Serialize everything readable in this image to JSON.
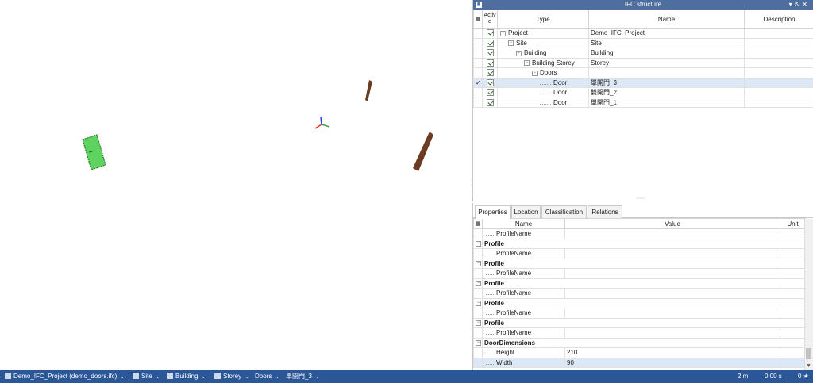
{
  "ifc_structure": {
    "title": "IFC structure",
    "title_icons": [
      "pin-icon",
      "float-icon",
      "close-icon"
    ],
    "columns": {
      "active": "Active",
      "type": "Type",
      "name": "Name",
      "description": "Description"
    },
    "rows": [
      {
        "type": "Project",
        "name": "Demo_IFC_Project",
        "description": "",
        "active": true,
        "selected": false
      },
      {
        "type": "Site",
        "name": "Site",
        "description": "",
        "active": true,
        "selected": false
      },
      {
        "type": "Building",
        "name": "Building",
        "description": "",
        "active": true,
        "selected": false
      },
      {
        "type": "Building Storey",
        "name": "Storey",
        "description": "",
        "active": true,
        "selected": false
      },
      {
        "type": "Doors",
        "name": "",
        "description": "",
        "active": true,
        "selected": false
      },
      {
        "type": "Door",
        "name": "單開門_3",
        "description": "",
        "active": true,
        "selected": true
      },
      {
        "type": "Door",
        "name": "雙開門_2",
        "description": "",
        "active": true,
        "selected": false
      },
      {
        "type": "Door",
        "name": "單開門_1",
        "description": "",
        "active": true,
        "selected": false
      }
    ]
  },
  "properties_panel": {
    "tabs": [
      "Properties",
      "Location",
      "Classification",
      "Relations"
    ],
    "active_tab": "Properties",
    "columns": {
      "name": "Name",
      "value": "Value",
      "unit": "Unit"
    },
    "rows": [
      {
        "kind": "prop",
        "name": "ProfileName",
        "value": "",
        "unit": ""
      },
      {
        "kind": "group",
        "name": "Profile"
      },
      {
        "kind": "prop",
        "name": "ProfileName",
        "value": "",
        "unit": ""
      },
      {
        "kind": "group",
        "name": "Profile"
      },
      {
        "kind": "prop",
        "name": "ProfileName",
        "value": "",
        "unit": ""
      },
      {
        "kind": "group",
        "name": "Profile"
      },
      {
        "kind": "prop",
        "name": "ProfileName",
        "value": "",
        "unit": ""
      },
      {
        "kind": "group",
        "name": "Profile"
      },
      {
        "kind": "prop",
        "name": "ProfileName",
        "value": "",
        "unit": ""
      },
      {
        "kind": "group",
        "name": "Profile"
      },
      {
        "kind": "prop",
        "name": "ProfileName",
        "value": "",
        "unit": ""
      },
      {
        "kind": "group",
        "name": "DoorDimensions"
      },
      {
        "kind": "prop",
        "name": "Height",
        "value": "210",
        "unit": ""
      },
      {
        "kind": "prop",
        "name": "Width",
        "value": "90",
        "unit": "",
        "selected": true
      }
    ]
  },
  "status_bar": {
    "breadcrumbs": [
      "Demo_IFC_Project (demo_doors.ifc)",
      "Site",
      "Building",
      "Storey",
      "Doors",
      "單開門_3"
    ],
    "scale": "2 m",
    "time": "0.00 s",
    "count": "0 ★"
  },
  "viewport": {
    "selected_door_color": "#5fd35f",
    "door_color": "#6b3b22",
    "axis_colors": {
      "x": "#e53935",
      "y": "#43a047",
      "z": "#1e3fd8"
    }
  }
}
